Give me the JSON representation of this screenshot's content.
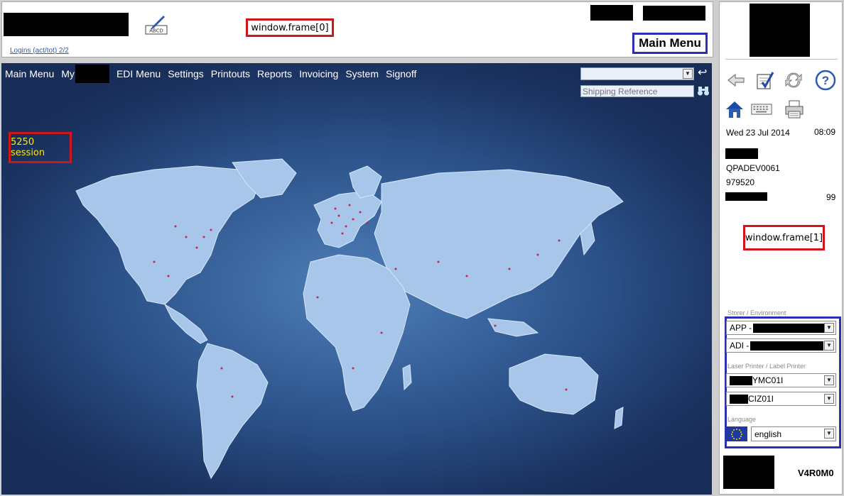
{
  "header": {
    "logins_link": "Logins (act/tot) 2/2",
    "frame0_annotation": "window.frame[0]",
    "main_menu_annotation": "Main Menu"
  },
  "menubar": {
    "items": [
      "Main Menu",
      "My",
      "EDI Menu",
      "Settings",
      "Printouts",
      "Reports",
      "Invoicing",
      "System",
      "Signoff"
    ]
  },
  "search": {
    "shipping_reference_placeholder": "Shipping Reference"
  },
  "main": {
    "session_annotation": "5250 session"
  },
  "right_panel": {
    "date": "Wed 23 Jul 2014",
    "time": "08:09",
    "device": "QPADEV0061",
    "job_number": "979520",
    "count": "99",
    "frame1_annotation": "window.frame[1]",
    "storer_label": "Storer / Environment",
    "storer_value": "APP -",
    "environment_value": "ADI -",
    "printer_label": "Laser Printer / Label Printer",
    "laser_printer_suffix": "YMC01I",
    "label_printer_suffix": "CIZ01I",
    "language_label": "Language",
    "language_value": "english",
    "version": "V4R0M0"
  },
  "icons": {
    "signature": "signature-pen-icon",
    "back": "back-arrow-icon",
    "checklist": "checklist-icon",
    "refresh": "refresh-icon",
    "help": "help-icon",
    "home": "home-icon",
    "keyboard": "keyboard-icon",
    "print": "printer-icon",
    "search": "binoculars-icon",
    "flag": "eu-flag-icon"
  },
  "colors": {
    "annotation_red": "#d0151c",
    "annotation_blue": "#2b2fb0",
    "map_background": "#2a4f86",
    "session_text": "#ffe600"
  }
}
